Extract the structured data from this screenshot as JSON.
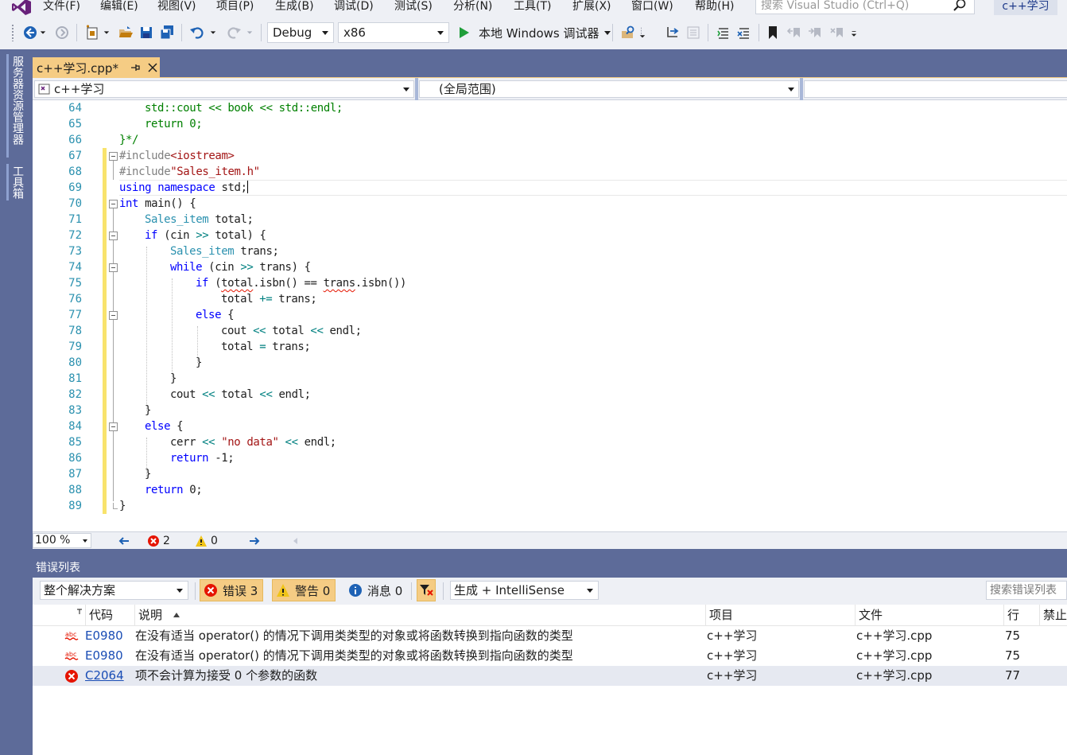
{
  "menu": {
    "items": [
      "文件(F)",
      "编辑(E)",
      "视图(V)",
      "项目(P)",
      "生成(B)",
      "调试(D)",
      "测试(S)",
      "分析(N)",
      "工具(T)",
      "扩展(X)",
      "窗口(W)",
      "帮助(H)"
    ],
    "search_placeholder": "搜索 Visual Studio (Ctrl+Q)",
    "solution_name": "c++学习"
  },
  "toolbar": {
    "configuration": "Debug",
    "platform": "x86",
    "run_label": "本地 Windows 调试器"
  },
  "side_panel": {
    "tabs": [
      "服务器资源管理器",
      "工具箱"
    ]
  },
  "document": {
    "tab_title": "c++学习.cpp*",
    "project_combo": "c++学习",
    "scope_combo": "(全局范围)"
  },
  "editor": {
    "lines": [
      {
        "n": "64",
        "fold": false
      },
      {
        "n": "65",
        "fold": false
      },
      {
        "n": "66",
        "fold": false
      },
      {
        "n": "67",
        "fold": true
      },
      {
        "n": "68",
        "fold": false
      },
      {
        "n": "69",
        "fold": false
      },
      {
        "n": "70",
        "fold": true
      },
      {
        "n": "71",
        "fold": false
      },
      {
        "n": "72",
        "fold": true
      },
      {
        "n": "73",
        "fold": false
      },
      {
        "n": "74",
        "fold": true
      },
      {
        "n": "75",
        "fold": false
      },
      {
        "n": "76",
        "fold": false
      },
      {
        "n": "77",
        "fold": true
      },
      {
        "n": "78",
        "fold": false
      },
      {
        "n": "79",
        "fold": false
      },
      {
        "n": "80",
        "fold": false
      },
      {
        "n": "81",
        "fold": false
      },
      {
        "n": "82",
        "fold": false
      },
      {
        "n": "83",
        "fold": false
      },
      {
        "n": "84",
        "fold": true
      },
      {
        "n": "85",
        "fold": false
      },
      {
        "n": "86",
        "fold": false
      },
      {
        "n": "87",
        "fold": false
      },
      {
        "n": "88",
        "fold": false
      },
      {
        "n": "89",
        "fold": false
      }
    ],
    "code": {
      "l64a": "std::cout ",
      "l64b": "<<",
      "l64c": " book ",
      "l64d": "<<",
      "l64e": " std::endl;",
      "l65a": "return",
      "l65b": " 0;",
      "l66": "}*/",
      "l67a": "#include",
      "l67b": "<iostream>",
      "l68a": "#include",
      "l68b": "\"Sales_item.h\"",
      "l69a": "using",
      "l69b": " ",
      "l69c": "namespace",
      "l69d": " std;",
      "l70a": "int",
      "l70b": " main() {",
      "l71a": "Sales_item",
      "l71b": " total;",
      "l72a": "if",
      "l72b": " (cin ",
      "l72c": ">>",
      "l72d": " total) {",
      "l73a": "Sales_item",
      "l73b": " trans;",
      "l74a": "while",
      "l74b": " (cin ",
      "l74c": ">>",
      "l74d": " trans) {",
      "l75a": "if",
      "l75b": " (",
      "l75c": "total",
      "l75d": ".isbn() == ",
      "l75e": "trans",
      "l75f": ".isbn())",
      "l76a": "total ",
      "l76b": "+=",
      "l76c": " trans;",
      "l77a": "else",
      "l77b": " {",
      "l78a": "cout ",
      "l78b": "<<",
      "l78c": " total ",
      "l78d": "<<",
      "l78e": " endl;",
      "l79a": "total ",
      "l79b": "=",
      "l79c": " trans;",
      "l80": "}",
      "l81": "}",
      "l82a": "cout ",
      "l82b": "<<",
      "l82c": " total ",
      "l82d": "<<",
      "l82e": " endl;",
      "l83": "}",
      "l84a": "else",
      "l84b": " {",
      "l85a": "cerr ",
      "l85b": "<<",
      "l85c": " ",
      "l85d": "\"no data\"",
      "l85e": " ",
      "l85f": "<<",
      "l85g": " endl;",
      "l86a": "return",
      "l86b": " -1;",
      "l87": "}",
      "l88a": "return",
      "l88b": " 0;",
      "l89": "}"
    }
  },
  "status": {
    "zoom": "100 %",
    "errors": "2",
    "warnings": "0"
  },
  "error_list": {
    "title": "错误列表",
    "scope": "整个解决方案",
    "errors_filter": "错误 3",
    "warnings_filter": "警告 0",
    "messages_filter": "消息 0",
    "source": "生成 + IntelliSense",
    "search_placeholder": "搜索错误列表",
    "columns": {
      "code": "代码",
      "description": "说明",
      "project": "项目",
      "file": "文件",
      "line": "行",
      "suppress": "禁止"
    },
    "rows": [
      {
        "code": "E0980",
        "description": "在没有适当 operator() 的情况下调用类类型的对象或将函数转换到指向函数的类型",
        "project": "c++学习",
        "file": "c++学习.cpp",
        "line": "75",
        "kind": "intellisense"
      },
      {
        "code": "E0980",
        "description": "在没有适当 operator() 的情况下调用类类型的对象或将函数转换到指向函数的类型",
        "project": "c++学习",
        "file": "c++学习.cpp",
        "line": "75",
        "kind": "intellisense"
      },
      {
        "code": "C2064",
        "description": "项不会计算为接受 0 个参数的函数",
        "project": "c++学习",
        "file": "c++学习.cpp",
        "line": "77",
        "kind": "error"
      }
    ]
  },
  "colors": {
    "accent_tab": "#f5cc84",
    "chrome_blue": "#5d6b99",
    "keyword": "#0000ff",
    "type": "#2b91af",
    "string": "#a31515",
    "error_red": "#e51400"
  }
}
